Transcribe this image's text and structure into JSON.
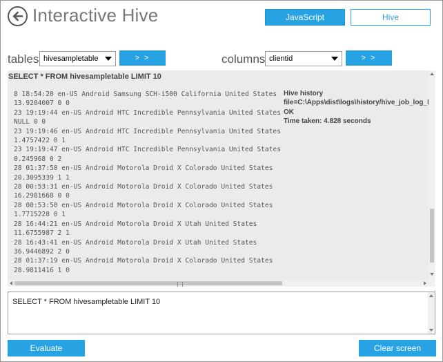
{
  "app": {
    "title": "Interactive Hive"
  },
  "header": {
    "javascript_label": "JavaScript",
    "hive_label": "Hive"
  },
  "tables": {
    "label": "tables",
    "selected": "hivesampletable",
    "go_label": "> >"
  },
  "columns": {
    "label": "columns",
    "selected": "clientid",
    "go_label": "> >"
  },
  "output": {
    "header": "SELECT * FROM hivesampletable LIMIT 10",
    "lines": [
      "8 18:54:20 en-US Android Samsung SCH-i500 California United States",
      "13.9204007 0 0",
      "23 19:19:44 en-US Android HTC Incredible Pennsylvania United States",
      "NULL 0 0",
      "23 19:19:46 en-US Android HTC Incredible Pennsylvania United States",
      "1.4757422 0 1",
      "23 19:19:47 en-US Android HTC Incredible Pennsylvania United States",
      "0.245968 0 2",
      "28 01:37:50 en-US Android Motorola Droid X Colorado United States",
      "20.3095339 1 1",
      "28 00:53:31 en-US Android Motorola Droid X Colorado United States",
      "16.2981668 0 0",
      "28 00:53:50 en-US Android Motorola Droid X Colorado United States",
      "1.7715228 0 1",
      "28 16:44:21 en-US Android Motorola Droid X Utah United States",
      "11.6755987 2 1",
      "28 16:43:41 en-US Android Motorola Droid X Utah United States",
      "36.9446892 2 0",
      "28 01:37:19 en-US Android Motorola Droid X Colorado United States",
      "28.9811416 1 0"
    ],
    "hive_info": [
      "Hive history",
      "file=C:\\Apps\\dist\\logs\\history/hive_job_log_R",
      "OK",
      "Time taken: 4.828 seconds"
    ]
  },
  "query": {
    "text": "SELECT * FROM hivesampletable LIMIT 10"
  },
  "actions": {
    "evaluate_label": "Evaluate",
    "clear_label": "Clear screen"
  },
  "colors": {
    "accent": "#27a3e3",
    "output_bg": "#ebebeb"
  }
}
